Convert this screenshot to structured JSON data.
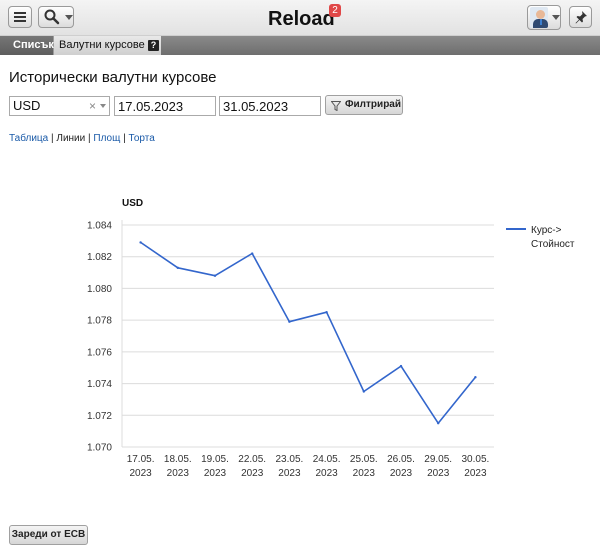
{
  "app": {
    "title": "Reload",
    "notification_count": "2"
  },
  "tabs": [
    {
      "label": "Списък",
      "active": false
    },
    {
      "label": "Валутни курсове",
      "active": true
    }
  ],
  "page": {
    "title": "Исторически валутни курсове"
  },
  "filters": {
    "currency": "USD",
    "date_from": "17.05.2023",
    "date_to": "31.05.2023",
    "filter_button": "Филтрирай"
  },
  "view_switch": {
    "table": "Таблица",
    "lines": "Линии",
    "area": "Площ",
    "pie": "Торта",
    "separator": "|"
  },
  "chart_data": {
    "type": "line",
    "ylabel": "USD",
    "categories": [
      [
        "17.05.",
        "2023"
      ],
      [
        "18.05.",
        "2023"
      ],
      [
        "19.05.",
        "2023"
      ],
      [
        "22.05.",
        "2023"
      ],
      [
        "23.05.",
        "2023"
      ],
      [
        "24.05.",
        "2023"
      ],
      [
        "25.05.",
        "2023"
      ],
      [
        "26.05.",
        "2023"
      ],
      [
        "29.05.",
        "2023"
      ],
      [
        "30.05.",
        "2023"
      ]
    ],
    "series": [
      {
        "name": "Курс->Стойност",
        "legend_lines": [
          "Курс->",
          "Стойност"
        ],
        "color": "#3366cc",
        "values": [
          1.0829,
          1.0813,
          1.0808,
          1.0822,
          1.0779,
          1.0785,
          1.0735,
          1.0751,
          1.0715,
          1.0744
        ]
      }
    ],
    "ylim": [
      1.07,
      1.084
    ],
    "yticks": [
      "1.084",
      "1.082",
      "1.080",
      "1.078",
      "1.076",
      "1.074",
      "1.072",
      "1.070"
    ],
    "grid": true,
    "legend_position": "right"
  },
  "actions": {
    "load_ecb": "Зареди от ECB"
  },
  "colors": {
    "accent_link": "#1a5aa8",
    "line": "#3366cc",
    "badge": "#e04848"
  },
  "icons": [
    "menu-icon",
    "search-icon",
    "avatar-icon",
    "pin-icon",
    "filter-icon",
    "help-icon"
  ]
}
